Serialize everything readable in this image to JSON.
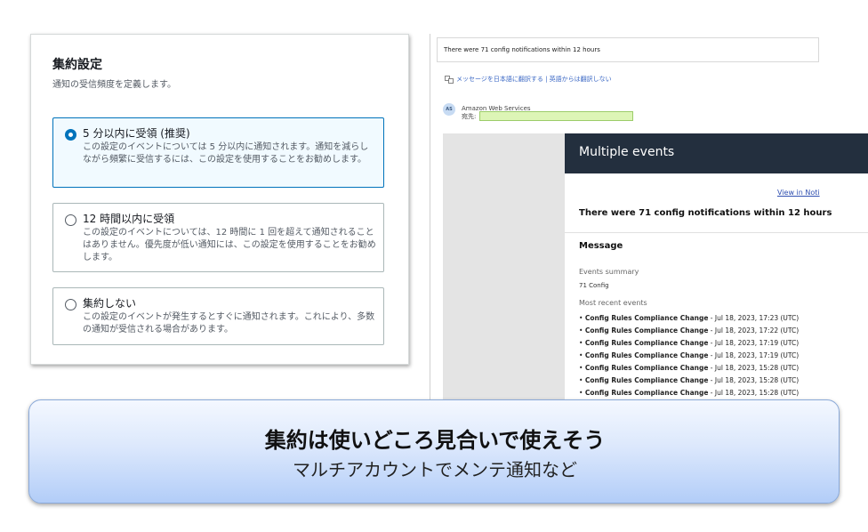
{
  "settings": {
    "title": "集約設定",
    "description": "通知の受信頻度を定義します。",
    "options": [
      {
        "label": "5 分以内に受領 (推奨)",
        "help": "この設定のイベントについては 5 分以内に通知されます。通知を減らしながら頻繁に受信するには、この設定を使用することをお勧めします。",
        "selected": true
      },
      {
        "label": "12 時間以内に受領",
        "help": "この設定のイベントについては、12 時間に 1 回を超えて通知されることはありません。優先度が低い通知には、この設定を使用することをお勧めします。",
        "selected": false
      },
      {
        "label": "集約しない",
        "help": "この設定のイベントが発生するとすぐに通知されます。これにより、多数の通知が受信される場合があります。",
        "selected": false
      }
    ]
  },
  "email": {
    "subject": "There were 71 config notifications within 12 hours",
    "translate_text": "メッセージを日本語に翻訳する | 英語からは翻訳しない",
    "avatar_initials": "AS",
    "sender_name": "Amazon Web Services",
    "to_label": "宛先:",
    "header_title": "Multiple events",
    "view_link": "View in Noti",
    "heading": "There were 71 config notifications within 12 hours",
    "message_label": "Message",
    "summary_label": "Events summary",
    "summary_value": "71 Config",
    "recent_label": "Most recent events",
    "events": [
      {
        "name": "Config Rules Compliance Change",
        "time": "Jul 18, 2023, 17:23 (UTC)"
      },
      {
        "name": "Config Rules Compliance Change",
        "time": "Jul 18, 2023, 17:22 (UTC)"
      },
      {
        "name": "Config Rules Compliance Change",
        "time": "Jul 18, 2023, 17:19 (UTC)"
      },
      {
        "name": "Config Rules Compliance Change",
        "time": "Jul 18, 2023, 17:19 (UTC)"
      },
      {
        "name": "Config Rules Compliance Change",
        "time": "Jul 18, 2023, 15:28 (UTC)"
      },
      {
        "name": "Config Rules Compliance Change",
        "time": "Jul 18, 2023, 15:28 (UTC)"
      },
      {
        "name": "Config Rules Compliance Change",
        "time": "Jul 18, 2023, 15:28 (UTC)"
      }
    ]
  },
  "banner": {
    "title": "集約は使いどころ見合いで使えそう",
    "subtitle": "マルチアカウントでメンテ通知など"
  },
  "colors": {
    "accent": "#0073bb",
    "header_dark": "#232f3e",
    "redaction": "#ddf5b6"
  }
}
